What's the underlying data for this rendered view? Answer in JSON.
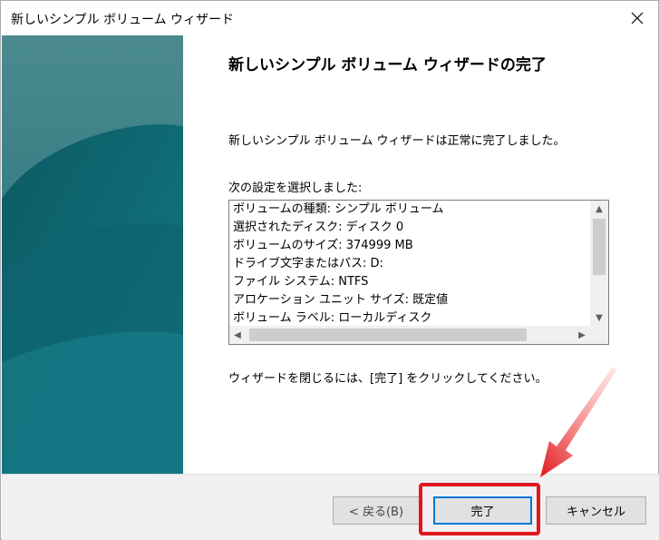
{
  "window": {
    "title": "新しいシンプル ボリューム ウィザード",
    "close_icon": "close-icon"
  },
  "content": {
    "heading": "新しいシンプル ボリューム ウィザードの完了",
    "success_message": "新しいシンプル ボリューム ウィザードは正常に完了しました。",
    "settings_label": "次の設定を選択しました:",
    "settings_items": [
      "ボリュームの種類: シンプル ボリューム",
      "選択されたディスク: ディスク 0",
      "ボリュームのサイズ: 374999 MB",
      "ドライブ文字またはパス: D:",
      "ファイル システム: NTFS",
      "アロケーション ユニット サイズ: 既定値",
      "ボリューム ラベル: ローカルディスク"
    ],
    "close_instruction": "ウィザードを閉じるには、[完了] をクリックしてください。"
  },
  "footer": {
    "back_label": "< 戻る(B)",
    "finish_label": "完了",
    "cancel_label": "キャンセル"
  },
  "colors": {
    "side_panel": "#1e6a72",
    "focus_border": "#0078d7",
    "annotation_red": "#e0171c"
  }
}
